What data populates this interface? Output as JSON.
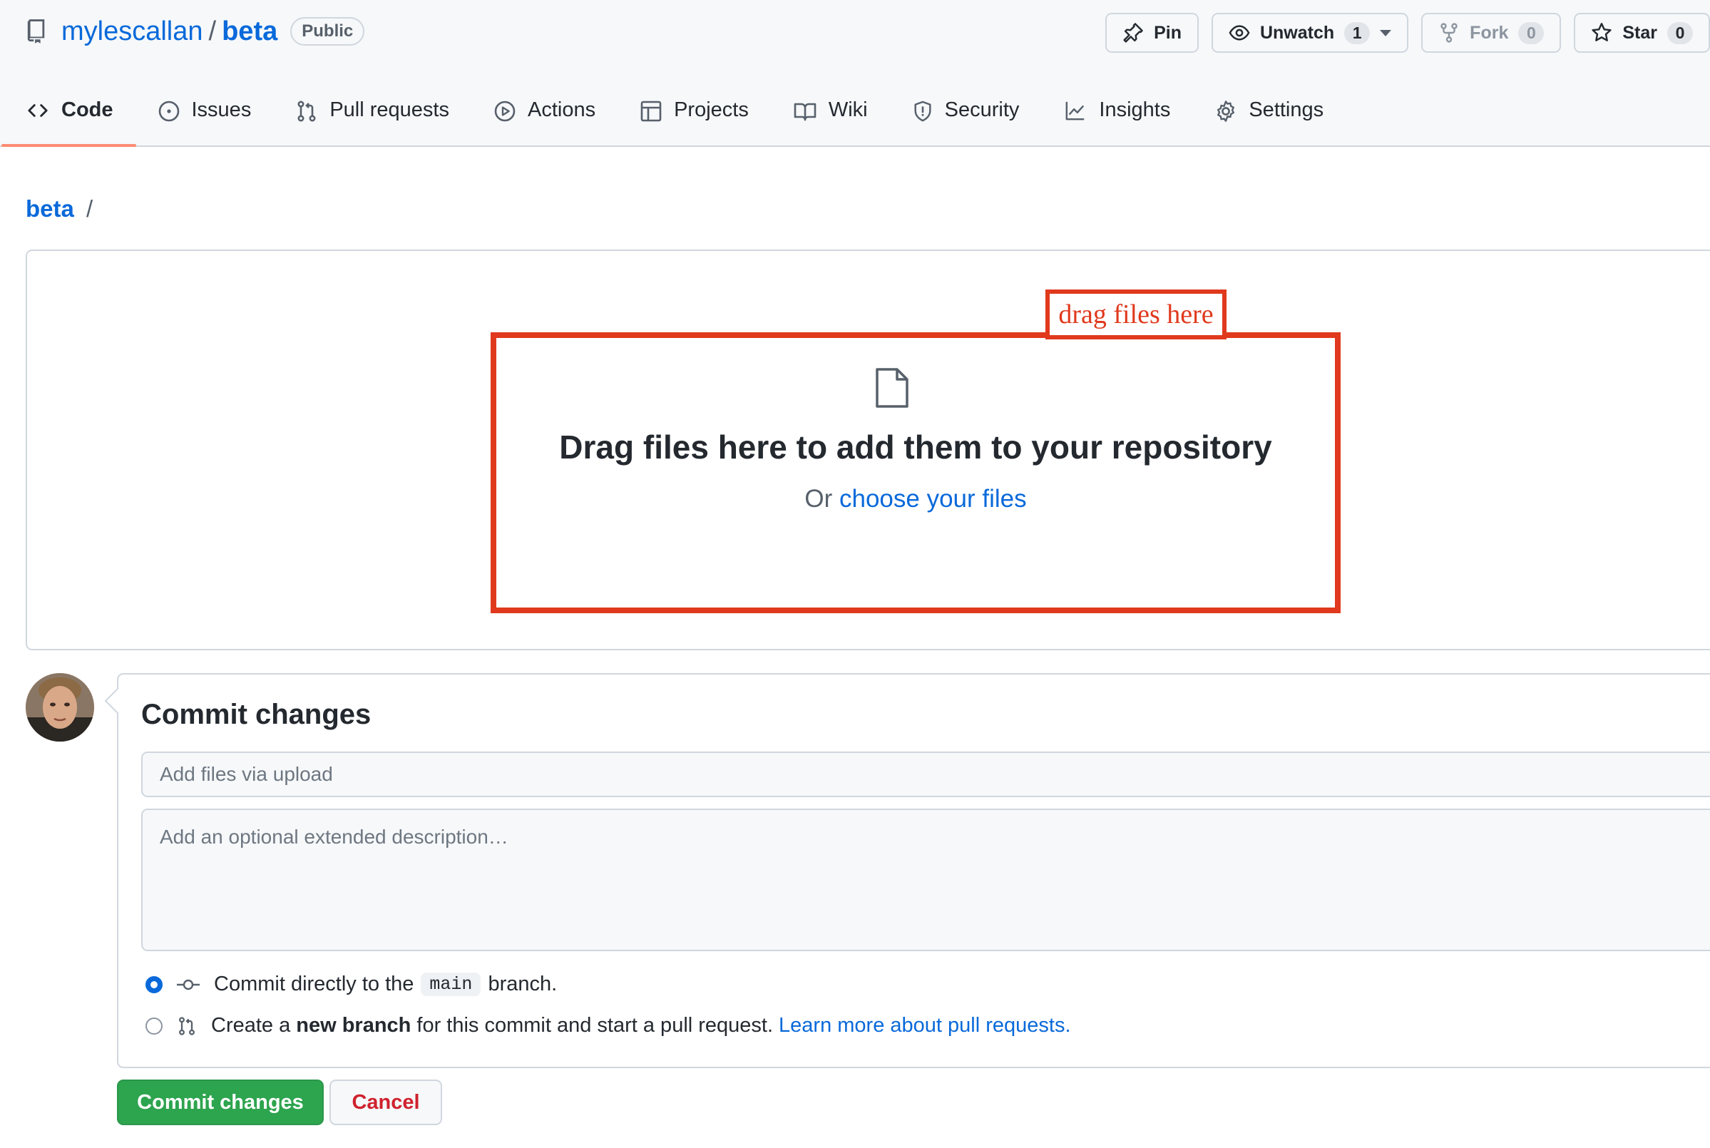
{
  "repo": {
    "owner": "mylescallan",
    "separator": "/",
    "name": "beta",
    "visibility": "Public",
    "icon": "repo-icon"
  },
  "actions": {
    "pin": {
      "label": "Pin",
      "icon": "pin-icon"
    },
    "unwatch": {
      "label": "Unwatch",
      "count": "1",
      "icon": "eye-icon"
    },
    "fork": {
      "label": "Fork",
      "count": "0",
      "icon": "fork-icon"
    },
    "star": {
      "label": "Star",
      "count": "0",
      "icon": "star-icon"
    }
  },
  "tabs": [
    {
      "label": "Code",
      "icon": "code-icon",
      "selected": true
    },
    {
      "label": "Issues",
      "icon": "issue-opened-icon"
    },
    {
      "label": "Pull requests",
      "icon": "git-pull-request-icon"
    },
    {
      "label": "Actions",
      "icon": "play-icon"
    },
    {
      "label": "Projects",
      "icon": "table-icon"
    },
    {
      "label": "Wiki",
      "icon": "book-icon"
    },
    {
      "label": "Security",
      "icon": "shield-icon"
    },
    {
      "label": "Insights",
      "icon": "graph-icon"
    },
    {
      "label": "Settings",
      "icon": "gear-icon"
    }
  ],
  "breadcrumb": {
    "repo": "beta",
    "separator": "/"
  },
  "dropzone": {
    "annotation": "drag files here",
    "title": "Drag files here to add them to your repository",
    "sub_prefix": "Or",
    "choose_link": "choose your files",
    "annotation_color": "#e0391d"
  },
  "commit": {
    "title": "Commit changes",
    "summary_placeholder": "Add files via upload",
    "description_placeholder": "Add an optional extended description…",
    "option_direct": {
      "prefix": "Commit directly to the",
      "branch": "main",
      "suffix": "branch.",
      "selected": true
    },
    "option_new_branch": {
      "prefix": "Create a",
      "bold": "new branch",
      "suffix": "for this commit and start a pull request.",
      "link": "Learn more about pull requests.",
      "selected": false
    },
    "submit_label": "Commit changes",
    "cancel_label": "Cancel"
  },
  "colors": {
    "link": "#0969da",
    "primary_button": "#2da44e",
    "danger_text": "#cf222e",
    "tab_underline": "#fd8c73"
  }
}
